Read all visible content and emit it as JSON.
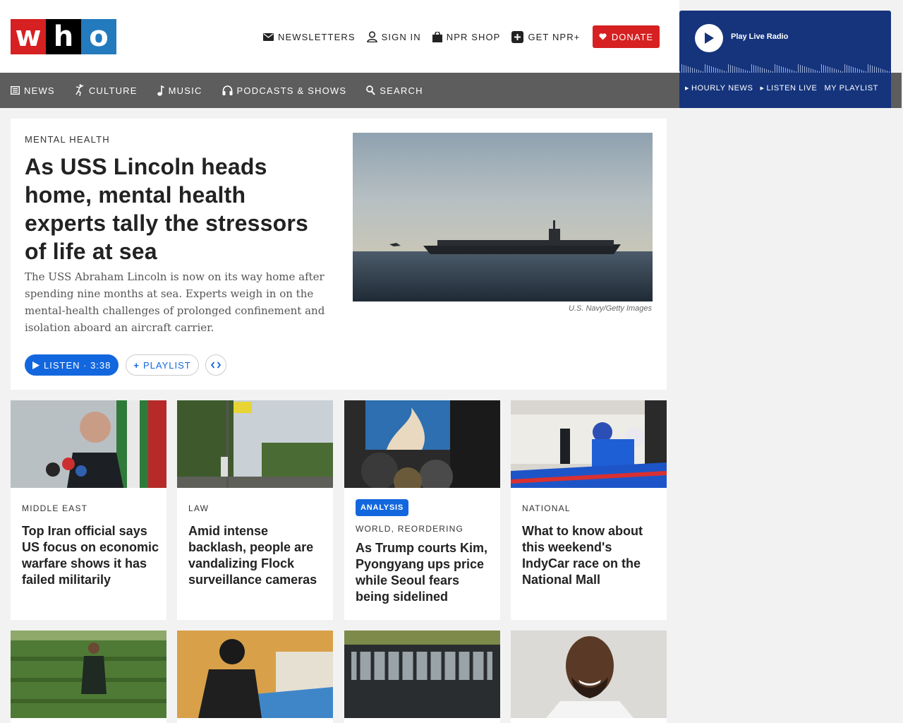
{
  "brand": {
    "letters": [
      "w",
      "h",
      "o"
    ],
    "colors": [
      "#d62021",
      "#000000",
      "#237bbd"
    ]
  },
  "utility": {
    "newsletters": "NEWSLETTERS",
    "sign_in": "SIGN IN",
    "shop": "NPR SHOP",
    "get_plus": "GET NPR+",
    "donate": "DONATE"
  },
  "nav": {
    "news": "NEWS",
    "culture": "CULTURE",
    "music": "MUSIC",
    "podcasts": "PODCASTS & SHOWS",
    "search": "SEARCH"
  },
  "player": {
    "play_label": "Play Live Radio",
    "links": [
      "HOURLY NEWS",
      "LISTEN LIVE",
      "MY PLAYLIST"
    ]
  },
  "hero": {
    "slug": "MENTAL HEALTH",
    "title": "As USS Lincoln heads home, mental health experts tally the stressors of life at sea",
    "teaser": "The USS Abraham Lincoln is now on its way home after spending nine months at sea. Experts weigh in on the mental-health challenges of prolonged confinement and isolation aboard an aircraft carrier.",
    "credit": "U.S. Navy/Getty Images",
    "listen": "LISTEN · 3:38",
    "playlist": "PLAYLIST"
  },
  "cards": [
    {
      "slug": "MIDDLE EAST",
      "title": "Top Iran official says US focus on economic warfare shows it has failed militarily"
    },
    {
      "slug": "LAW",
      "title": "Amid intense backlash, people are vandalizing Flock surveillance cameras"
    },
    {
      "badge": "ANALYSIS",
      "slug": "WORLD, REORDERING",
      "title": "As Trump courts Kim, Pyongyang ups price while Seoul fears being sidelined"
    },
    {
      "slug": "NATIONAL",
      "title": "What to know about this weekend's IndyCar race on the National Mall"
    }
  ],
  "colors": {
    "accent": "#1367de",
    "donate": "#d62021",
    "nav_bg": "#5d5d5d",
    "player_bg": "#15347c"
  }
}
